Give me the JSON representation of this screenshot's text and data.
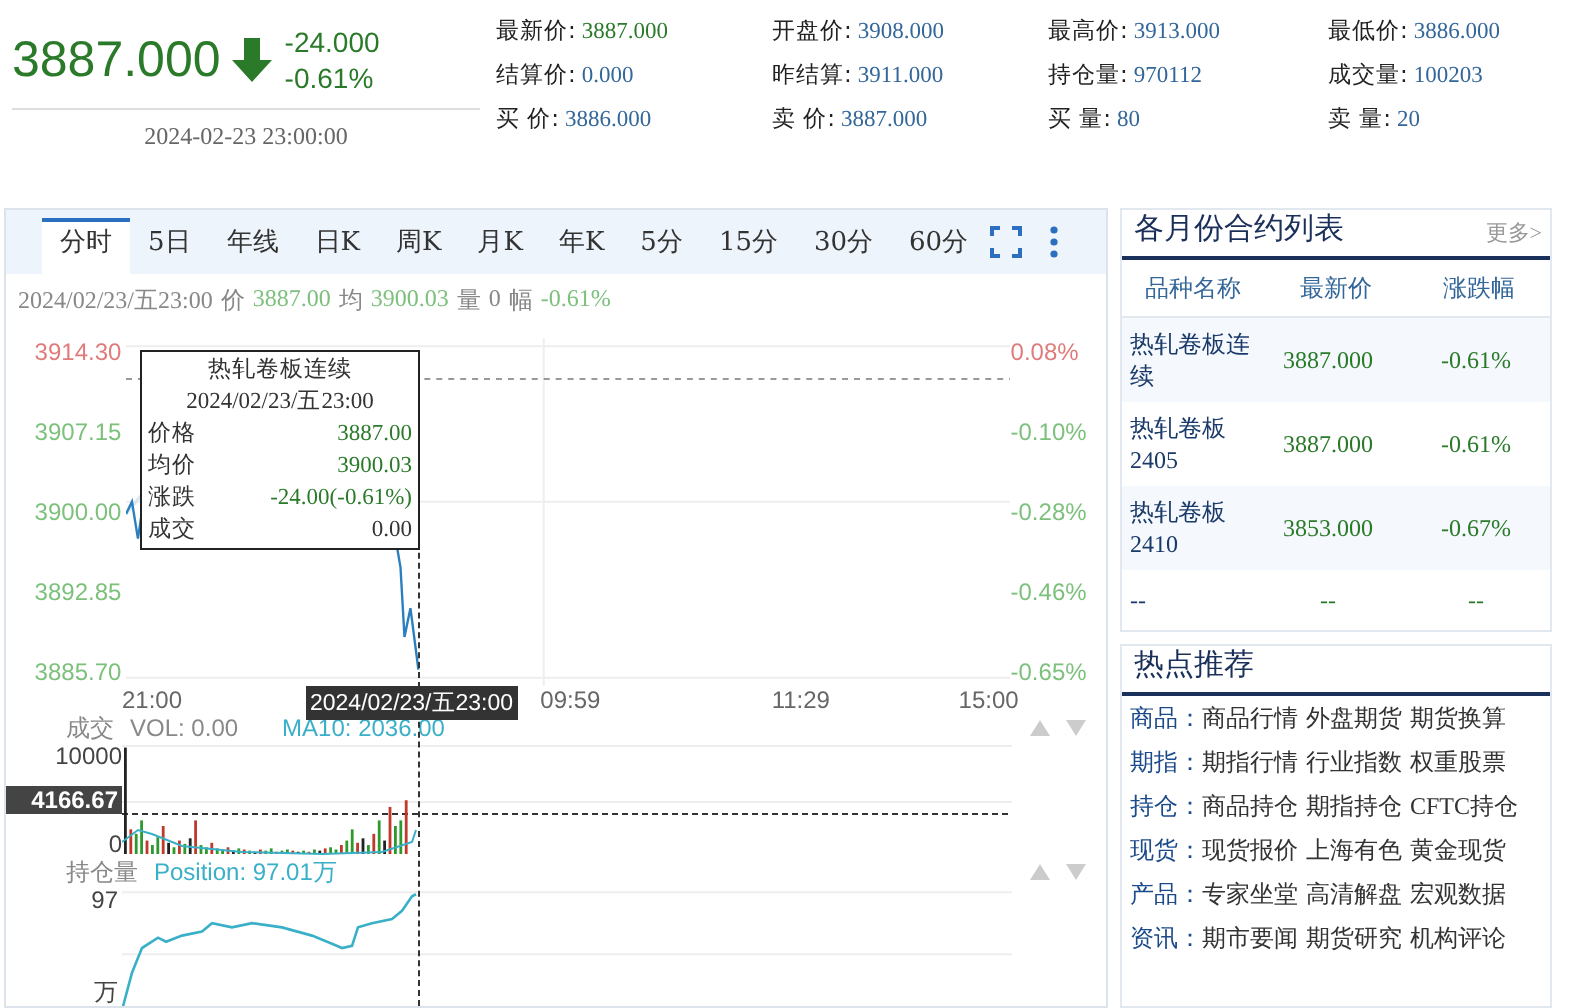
{
  "quote": {
    "price": "3887.000",
    "falling": true,
    "change": "-24.000",
    "change_pct": "-0.61%",
    "time": "2024-02-23 23:00:00"
  },
  "stats": [
    {
      "label": "最新价:",
      "value": "3887.000",
      "kind": "price"
    },
    {
      "label": "开盘价:",
      "value": "3908.000",
      "kind": "plain"
    },
    {
      "label": "最高价:",
      "value": "3913.000",
      "kind": "plain"
    },
    {
      "label": "最低价:",
      "value": "3886.000",
      "kind": "plain"
    },
    {
      "label": "结算价:",
      "value": "0.000",
      "kind": "plain"
    },
    {
      "label": "昨结算:",
      "value": "3911.000",
      "kind": "plain"
    },
    {
      "label": "持仓量:",
      "value": "970112",
      "kind": "plain"
    },
    {
      "label": "成交量:",
      "value": "100203",
      "kind": "plain"
    },
    {
      "label": "买 价:",
      "value": "3886.000",
      "kind": "plain"
    },
    {
      "label": "卖 价:",
      "value": "3887.000",
      "kind": "plain"
    },
    {
      "label": "买 量:",
      "value": "80",
      "kind": "plain"
    },
    {
      "label": "卖 量:",
      "value": "20",
      "kind": "plain"
    }
  ],
  "tabs": [
    {
      "label": "分时",
      "selected": true
    },
    {
      "label": "5日",
      "selected": false
    },
    {
      "label": "年线",
      "selected": false
    },
    {
      "label": "日K",
      "selected": false
    },
    {
      "label": "周K",
      "selected": false
    },
    {
      "label": "月K",
      "selected": false
    },
    {
      "label": "年K",
      "selected": false
    },
    {
      "label": "5分",
      "selected": false
    },
    {
      "label": "15分",
      "selected": false
    },
    {
      "label": "30分",
      "selected": false
    },
    {
      "label": "60分",
      "selected": false
    }
  ],
  "info": {
    "date": "2024/02/23/五23:00",
    "price_label": "价",
    "price": "3887.00",
    "avg_label": "均",
    "avg": "3900.03",
    "vol_label": "量",
    "vol": "0",
    "amp_label": "幅",
    "amp": "-0.61%"
  },
  "chart": {
    "y_left": [
      {
        "label": "3914.30",
        "rising": true
      },
      {
        "label": "3907.15",
        "rising": false
      },
      {
        "label": "3900.00",
        "rising": false
      },
      {
        "label": "3892.85",
        "rising": false
      },
      {
        "label": "3885.70",
        "rising": false
      }
    ],
    "y_right": [
      {
        "label": "0.08%",
        "rising": true
      },
      {
        "label": "-0.10%",
        "rising": false
      },
      {
        "label": "-0.28%",
        "rising": false
      },
      {
        "label": "-0.46%",
        "rising": false
      },
      {
        "label": "-0.65%",
        "rising": false
      }
    ],
    "x_labels": [
      "21:00",
      "09:59",
      "11:29",
      "15:00"
    ],
    "cursor_label": "2024/02/23/五23:00"
  },
  "tooltip": {
    "title": "热轧卷板连续",
    "time": "2024/02/23/五23:00",
    "rows": [
      {
        "label": "价格",
        "value": "3887.00"
      },
      {
        "label": "均价",
        "value": "3900.03"
      },
      {
        "label": "涨跌",
        "value": "-24.00(-0.61%)"
      },
      {
        "label": "成交",
        "value": "0.00"
      }
    ]
  },
  "volume": {
    "title": "成交",
    "vol": "VOL: 0.00",
    "ma": "MA10: 2036.00",
    "top_tick": "10000",
    "cursor_value": "4166.67",
    "bottom_tick": "0"
  },
  "position": {
    "title": "持仓量",
    "value": "Position: 97.01万",
    "top_tick": "97",
    "bottom_tick": "万"
  },
  "contracts": {
    "title": "各月份合约列表",
    "more": "更多>",
    "columns": [
      "品种名称",
      "最新价",
      "涨跌幅"
    ],
    "rows": [
      {
        "name": "热轧卷板连续",
        "price": "3887.000",
        "change": "-0.61%"
      },
      {
        "name": "热轧卷板2405",
        "price": "3887.000",
        "change": "-0.61%"
      },
      {
        "name": "热轧卷板2410",
        "price": "3853.000",
        "change": "-0.67%"
      },
      {
        "name": "--",
        "price": "--",
        "change": "--"
      }
    ]
  },
  "hot": {
    "title": "热点推荐",
    "rows": [
      {
        "category": "商品：",
        "links": [
          "商品行情",
          "外盘期货",
          "期货换算"
        ]
      },
      {
        "category": "期指：",
        "links": [
          "期指行情",
          "行业指数",
          "权重股票"
        ]
      },
      {
        "category": "持仓：",
        "links": [
          "商品持仓",
          "期指持仓",
          "CFTC持仓"
        ]
      },
      {
        "category": "现货：",
        "links": [
          "现货报价",
          "上海有色",
          "黄金现货"
        ]
      },
      {
        "category": "产品：",
        "links": [
          "专家坐堂",
          "高清解盘",
          "宏观数据"
        ]
      },
      {
        "category": "资讯：",
        "links": [
          "期市要闻",
          "期货研究",
          "机构评论"
        ]
      }
    ]
  }
}
